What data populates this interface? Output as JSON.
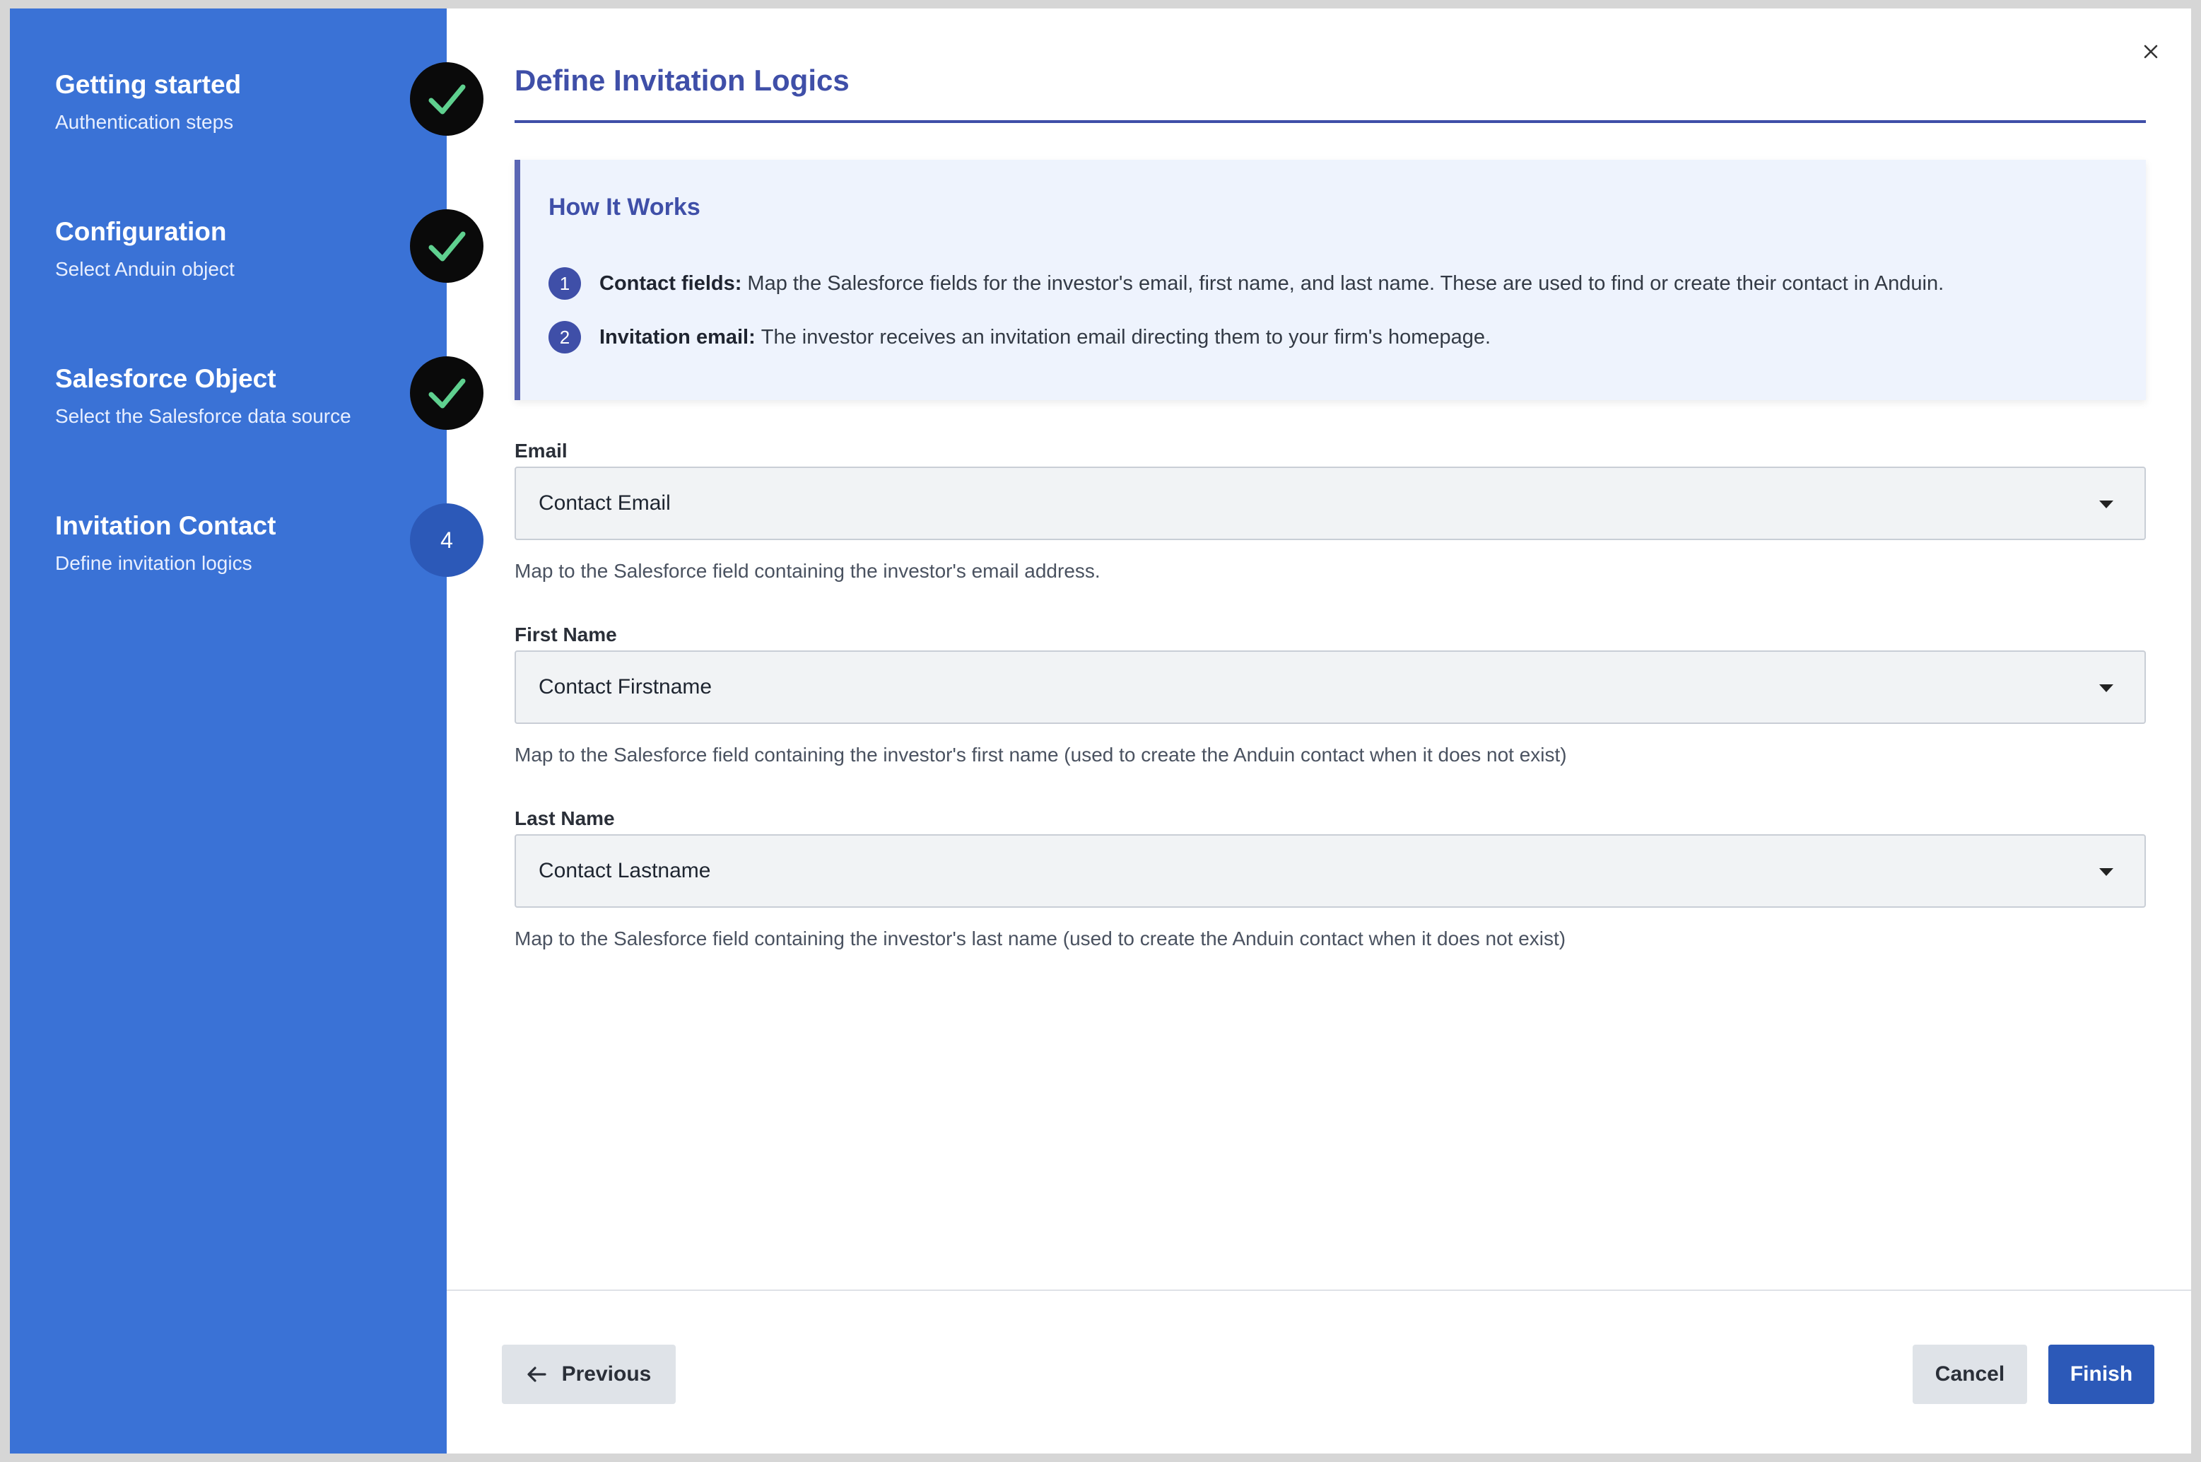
{
  "sidebar": {
    "steps": [
      {
        "title": "Getting started",
        "subtitle": "Authentication steps",
        "status": "complete",
        "icon": "check-icon"
      },
      {
        "title": "Configuration",
        "subtitle": "Select Anduin object",
        "status": "complete",
        "icon": "check-icon"
      },
      {
        "title": "Salesforce Object",
        "subtitle": "Select the Salesforce data source",
        "status": "complete",
        "icon": "check-icon"
      },
      {
        "title": "Invitation Contact",
        "subtitle": "Define invitation logics",
        "status": "current",
        "number": "4"
      }
    ]
  },
  "header": {
    "title": "Define Invitation Logics",
    "close_icon": "close-icon"
  },
  "how_it_works": {
    "title": "How It Works",
    "items": [
      {
        "number": "1",
        "label": "Contact fields:",
        "text": "Map the Salesforce fields for the investor's email, first name, and last name. These are used to find or create their contact in Anduin."
      },
      {
        "number": "2",
        "label": "Invitation email:",
        "text": "The investor receives an invitation email directing them to your firm's homepage."
      }
    ]
  },
  "fields": [
    {
      "label": "Email",
      "value": "Contact Email",
      "helper": "Map to the Salesforce field containing the investor's email address."
    },
    {
      "label": "First Name",
      "value": "Contact Firstname",
      "helper": "Map to the Salesforce field containing the investor's first name (used to create the Anduin contact when it does not exist)"
    },
    {
      "label": "Last Name",
      "value": "Contact Lastname",
      "helper": "Map to the Salesforce field containing the investor's last name (used to create the Anduin contact when it does not exist)"
    }
  ],
  "footer": {
    "previous_label": "Previous",
    "cancel_label": "Cancel",
    "finish_label": "Finish"
  },
  "colors": {
    "sidebar": "#3a72d6",
    "accent": "#3f4fa8",
    "primary_button": "#2c59b8",
    "check": "#5fd08f"
  }
}
